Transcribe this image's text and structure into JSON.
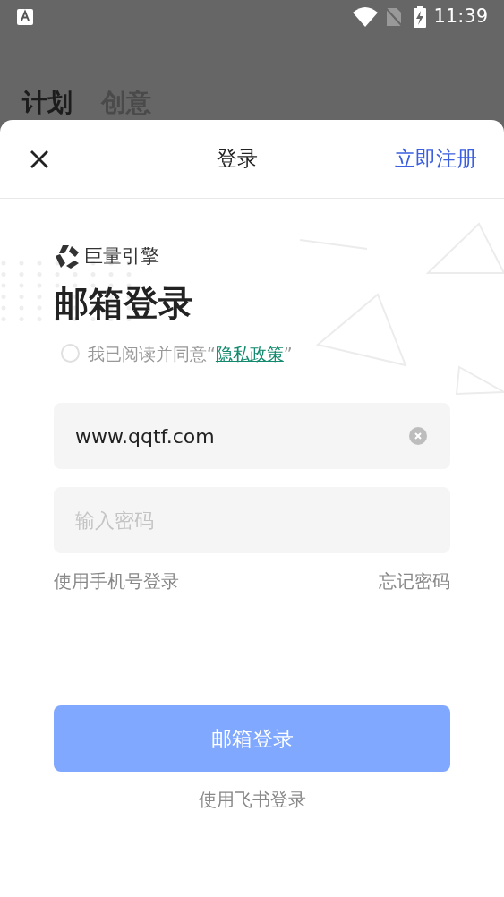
{
  "status_bar": {
    "time": "11:39"
  },
  "background_tabs": [
    {
      "label": "计划",
      "selected": true
    },
    {
      "label": "创意",
      "selected": false
    }
  ],
  "sheet": {
    "title": "登录",
    "register_link": "立即注册"
  },
  "brand": {
    "name": "巨量引擎"
  },
  "heading": "邮箱登录",
  "agreement": {
    "checked": false,
    "prefix": "我已阅读并同意“",
    "link": "隐私政策",
    "suffix": "”"
  },
  "email_field": {
    "value": "www.qqtf.com"
  },
  "password_field": {
    "placeholder": "输入密码"
  },
  "phone_login_link": "使用手机号登录",
  "forgot_password_link": "忘记密码",
  "submit_button": {
    "label": "邮箱登录",
    "disabled": true
  },
  "feishu_login_link": "使用飞书登录"
}
